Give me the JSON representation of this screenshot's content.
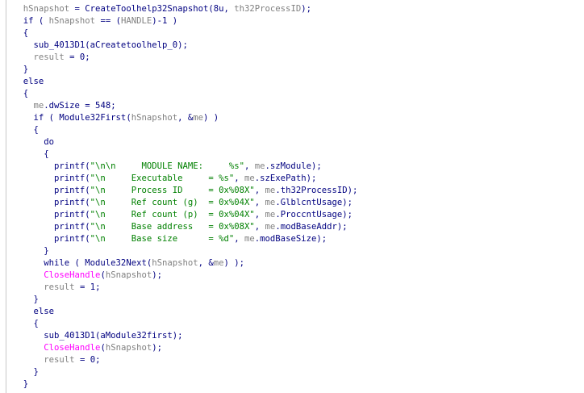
{
  "colors": {
    "plain": "#000080",
    "variable": "#808080",
    "import_call": "#ff00ff",
    "string": "#008000",
    "background": "#ffffff"
  },
  "lines": [
    [
      {
        "t": "plain",
        "s": "  "
      },
      {
        "t": "var",
        "s": "hSnapshot"
      },
      {
        "t": "plain",
        "s": " = CreateToolhelp32Snapshot(8u, "
      },
      {
        "t": "var",
        "s": "th32ProcessID"
      },
      {
        "t": "plain",
        "s": ");"
      }
    ],
    [
      {
        "t": "plain",
        "s": "  if ( "
      },
      {
        "t": "var",
        "s": "hSnapshot"
      },
      {
        "t": "plain",
        "s": " == ("
      },
      {
        "t": "var",
        "s": "HANDLE"
      },
      {
        "t": "plain",
        "s": ")-1 )"
      }
    ],
    [
      {
        "t": "plain",
        "s": "  {"
      }
    ],
    [
      {
        "t": "plain",
        "s": "    sub_4013D1(aCreatetoolhelp_0);"
      }
    ],
    [
      {
        "t": "plain",
        "s": "    "
      },
      {
        "t": "var",
        "s": "result"
      },
      {
        "t": "plain",
        "s": " = 0;"
      }
    ],
    [
      {
        "t": "plain",
        "s": "  }"
      }
    ],
    [
      {
        "t": "plain",
        "s": "  else"
      }
    ],
    [
      {
        "t": "plain",
        "s": "  {"
      }
    ],
    [
      {
        "t": "plain",
        "s": "    "
      },
      {
        "t": "var",
        "s": "me"
      },
      {
        "t": "plain",
        "s": ".dwSize = 548;"
      }
    ],
    [
      {
        "t": "plain",
        "s": "    if ( Module32First("
      },
      {
        "t": "var",
        "s": "hSnapshot"
      },
      {
        "t": "plain",
        "s": ", &"
      },
      {
        "t": "var",
        "s": "me"
      },
      {
        "t": "plain",
        "s": ") )"
      }
    ],
    [
      {
        "t": "plain",
        "s": "    {"
      }
    ],
    [
      {
        "t": "plain",
        "s": "      do"
      }
    ],
    [
      {
        "t": "plain",
        "s": "      {"
      }
    ],
    [
      {
        "t": "plain",
        "s": "        printf("
      },
      {
        "t": "str",
        "s": "\"\\n\\n     MODULE NAME:     %s\""
      },
      {
        "t": "plain",
        "s": ", "
      },
      {
        "t": "var",
        "s": "me"
      },
      {
        "t": "plain",
        "s": ".szModule);"
      }
    ],
    [
      {
        "t": "plain",
        "s": "        printf("
      },
      {
        "t": "str",
        "s": "\"\\n     Executable     = %s\""
      },
      {
        "t": "plain",
        "s": ", "
      },
      {
        "t": "var",
        "s": "me"
      },
      {
        "t": "plain",
        "s": ".szExePath);"
      }
    ],
    [
      {
        "t": "plain",
        "s": "        printf("
      },
      {
        "t": "str",
        "s": "\"\\n     Process ID     = 0x%08X\""
      },
      {
        "t": "plain",
        "s": ", "
      },
      {
        "t": "var",
        "s": "me"
      },
      {
        "t": "plain",
        "s": ".th32ProcessID);"
      }
    ],
    [
      {
        "t": "plain",
        "s": "        printf("
      },
      {
        "t": "str",
        "s": "\"\\n     Ref count (g)  = 0x%04X\""
      },
      {
        "t": "plain",
        "s": ", "
      },
      {
        "t": "var",
        "s": "me"
      },
      {
        "t": "plain",
        "s": ".GlblcntUsage);"
      }
    ],
    [
      {
        "t": "plain",
        "s": "        printf("
      },
      {
        "t": "str",
        "s": "\"\\n     Ref count (p)  = 0x%04X\""
      },
      {
        "t": "plain",
        "s": ", "
      },
      {
        "t": "var",
        "s": "me"
      },
      {
        "t": "plain",
        "s": ".ProccntUsage);"
      }
    ],
    [
      {
        "t": "plain",
        "s": "        printf("
      },
      {
        "t": "str",
        "s": "\"\\n     Base address   = 0x%08X\""
      },
      {
        "t": "plain",
        "s": ", "
      },
      {
        "t": "var",
        "s": "me"
      },
      {
        "t": "plain",
        "s": ".modBaseAddr);"
      }
    ],
    [
      {
        "t": "plain",
        "s": "        printf("
      },
      {
        "t": "str",
        "s": "\"\\n     Base size      = %d\""
      },
      {
        "t": "plain",
        "s": ", "
      },
      {
        "t": "var",
        "s": "me"
      },
      {
        "t": "plain",
        "s": ".modBaseSize);"
      }
    ],
    [
      {
        "t": "plain",
        "s": "      }"
      }
    ],
    [
      {
        "t": "plain",
        "s": "      while ( Module32Next("
      },
      {
        "t": "var",
        "s": "hSnapshot"
      },
      {
        "t": "plain",
        "s": ", &"
      },
      {
        "t": "var",
        "s": "me"
      },
      {
        "t": "plain",
        "s": ") );"
      }
    ],
    [
      {
        "t": "plain",
        "s": "      "
      },
      {
        "t": "api",
        "s": "CloseHandle"
      },
      {
        "t": "plain",
        "s": "("
      },
      {
        "t": "var",
        "s": "hSnapshot"
      },
      {
        "t": "plain",
        "s": ");"
      }
    ],
    [
      {
        "t": "plain",
        "s": "      "
      },
      {
        "t": "var",
        "s": "result"
      },
      {
        "t": "plain",
        "s": " = 1;"
      }
    ],
    [
      {
        "t": "plain",
        "s": "    }"
      }
    ],
    [
      {
        "t": "plain",
        "s": "    else"
      }
    ],
    [
      {
        "t": "plain",
        "s": "    {"
      }
    ],
    [
      {
        "t": "plain",
        "s": "      sub_4013D1(aModule32first);"
      }
    ],
    [
      {
        "t": "plain",
        "s": "      "
      },
      {
        "t": "api",
        "s": "CloseHandle"
      },
      {
        "t": "plain",
        "s": "("
      },
      {
        "t": "var",
        "s": "hSnapshot"
      },
      {
        "t": "plain",
        "s": ");"
      }
    ],
    [
      {
        "t": "plain",
        "s": "      "
      },
      {
        "t": "var",
        "s": "result"
      },
      {
        "t": "plain",
        "s": " = 0;"
      }
    ],
    [
      {
        "t": "plain",
        "s": "    }"
      }
    ],
    [
      {
        "t": "plain",
        "s": "  }"
      }
    ]
  ]
}
